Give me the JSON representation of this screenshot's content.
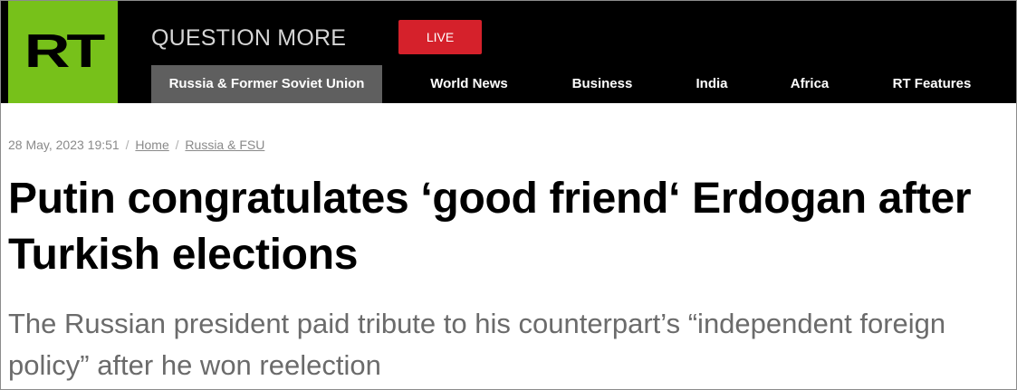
{
  "header": {
    "logo_text": "RT",
    "slogan": "QUESTION MORE",
    "live_label": "LIVE",
    "colors": {
      "background": "#000000",
      "logo": "#77c11a",
      "live": "#d5212b",
      "active_nav": "#5f5f5f"
    }
  },
  "nav": {
    "items": [
      {
        "label": "Russia & Former Soviet Union",
        "active": true
      },
      {
        "label": "World News",
        "active": false
      },
      {
        "label": "Business",
        "active": false
      },
      {
        "label": "India",
        "active": false
      },
      {
        "label": "Africa",
        "active": false
      },
      {
        "label": "RT Features",
        "active": false
      }
    ]
  },
  "article": {
    "timestamp": "28 May, 2023 19:51",
    "breadcrumb": [
      "Home",
      "Russia & FSU"
    ],
    "separator": "/",
    "headline": "Putin congratulates ‘good friend‘ Erdogan after Turkish elections",
    "summary": "The Russian president paid tribute to his counterpart’s “independent foreign policy” after he won reelection"
  }
}
